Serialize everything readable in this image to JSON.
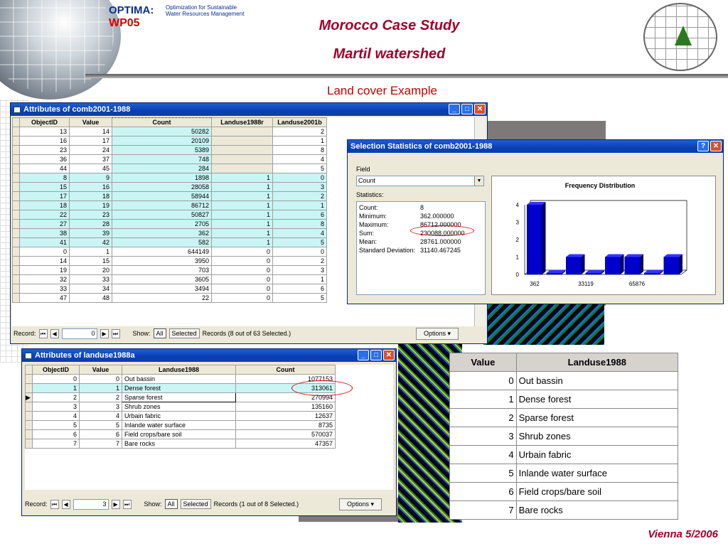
{
  "header": {
    "optima": "OPTIMA:",
    "wp": "WP05",
    "optima_sub1": "Optimization for Sustainable",
    "optima_sub2": "Water Resources Management",
    "title1": "Morocco Case Study",
    "title2": "Martil watershed",
    "subtitle": "Land cover Example",
    "footer": "Vienna 5/2006"
  },
  "win1": {
    "title": "Attributes of comb2001-1988",
    "columns": [
      "ObjectID",
      "Value",
      "Count",
      "Landuse1988r",
      "Landuse2001b"
    ],
    "rows": [
      [
        "13",
        "14",
        "50282",
        "",
        "2"
      ],
      [
        "16",
        "17",
        "20109",
        "",
        "1"
      ],
      [
        "23",
        "24",
        "5389",
        "",
        "8"
      ],
      [
        "36",
        "37",
        "748",
        "",
        "4"
      ],
      [
        "44",
        "45",
        "284",
        "",
        "5"
      ],
      [
        "8",
        "9",
        "1898",
        "1",
        "0"
      ],
      [
        "15",
        "16",
        "28058",
        "1",
        "3"
      ],
      [
        "17",
        "18",
        "58944",
        "1",
        "2"
      ],
      [
        "18",
        "19",
        "86712",
        "1",
        "1"
      ],
      [
        "22",
        "23",
        "50827",
        "1",
        "6"
      ],
      [
        "27",
        "28",
        "2705",
        "1",
        "8"
      ],
      [
        "38",
        "39",
        "362",
        "1",
        "4"
      ],
      [
        "41",
        "42",
        "582",
        "1",
        "5"
      ],
      [
        "0",
        "1",
        "644149",
        "0",
        "0"
      ],
      [
        "14",
        "15",
        "3950",
        "0",
        "2"
      ],
      [
        "19",
        "20",
        "703",
        "0",
        "3"
      ],
      [
        "32",
        "33",
        "3605",
        "0",
        "1"
      ],
      [
        "33",
        "34",
        "3494",
        "0",
        "6"
      ],
      [
        "47",
        "48",
        "22",
        "0",
        "5"
      ]
    ],
    "record_label": "Record:",
    "record_value": "0",
    "show_label": "Show:",
    "all_label": "All",
    "selected_label": "Selected",
    "records_text": "Records  (8 out of 63 Selected.)",
    "options_label": "Options"
  },
  "win2": {
    "title": "Attributes of landuse1988a",
    "columns": [
      "ObjectID",
      "Value",
      "Landuse1988",
      "Count"
    ],
    "rows": [
      [
        "0",
        "0",
        "Out bassin",
        "1077153"
      ],
      [
        "1",
        "1",
        "Dense forest",
        "313061"
      ],
      [
        "2",
        "2",
        "Sparse forest",
        "270994"
      ],
      [
        "3",
        "3",
        "Shrub zones",
        "135160"
      ],
      [
        "4",
        "4",
        "Urbain fabric",
        "12637"
      ],
      [
        "5",
        "5",
        "Inlande water surface",
        "8735"
      ],
      [
        "6",
        "6",
        "Field crops/bare soil",
        "570037"
      ],
      [
        "7",
        "7",
        "Bare rocks",
        "47357"
      ]
    ],
    "record_label": "Record:",
    "record_value": "3",
    "show_label": "Show:",
    "all_label": "All",
    "selected_label": "Selected",
    "records_text": "Records  (1 out of 8 Selected.)",
    "options_label": "Options"
  },
  "stats": {
    "title": "Selection Statistics of comb2001-1988",
    "field_label": "Field",
    "field_value": "Count",
    "statistics_label": "Statistics:",
    "items": [
      {
        "k": "Count:",
        "v": "8"
      },
      {
        "k": "Minimum:",
        "v": "362.000000"
      },
      {
        "k": "Maximum:",
        "v": "86712.000000"
      },
      {
        "k": "Sum:",
        "v": "230088.000000"
      },
      {
        "k": "Mean:",
        "v": "28761.000000"
      },
      {
        "k": "Standard Deviation:",
        "v": "31140.467245"
      }
    ]
  },
  "chart_data": {
    "type": "bar",
    "title": "Frequency Distribution",
    "values": [
      4,
      0,
      1,
      0,
      1,
      1,
      0,
      1
    ],
    "yticks": [
      0,
      1,
      2,
      3,
      4
    ],
    "xticks": [
      "362",
      "33119",
      "65876"
    ],
    "ylim": [
      0,
      4
    ],
    "color": "#0000cc"
  },
  "bigtable": {
    "columns": [
      "Value",
      "Landuse1988"
    ],
    "rows": [
      [
        "0",
        "Out  bassin"
      ],
      [
        "1",
        "Dense forest"
      ],
      [
        "2",
        "Sparse forest"
      ],
      [
        "3",
        "Shrub zones"
      ],
      [
        "4",
        "Urbain fabric"
      ],
      [
        "5",
        "Inlande water surface"
      ],
      [
        "6",
        "Field crops/bare soil"
      ],
      [
        "7",
        "Bare rocks"
      ]
    ]
  }
}
